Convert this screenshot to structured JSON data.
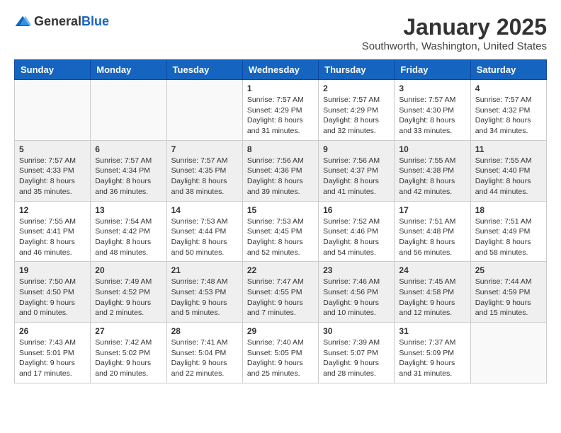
{
  "header": {
    "logo_general": "General",
    "logo_blue": "Blue",
    "month": "January 2025",
    "location": "Southworth, Washington, United States"
  },
  "days_of_week": [
    "Sunday",
    "Monday",
    "Tuesday",
    "Wednesday",
    "Thursday",
    "Friday",
    "Saturday"
  ],
  "weeks": [
    [
      {
        "day": "",
        "info": ""
      },
      {
        "day": "",
        "info": ""
      },
      {
        "day": "",
        "info": ""
      },
      {
        "day": "1",
        "info": "Sunrise: 7:57 AM\nSunset: 4:29 PM\nDaylight: 8 hours and 31 minutes."
      },
      {
        "day": "2",
        "info": "Sunrise: 7:57 AM\nSunset: 4:29 PM\nDaylight: 8 hours and 32 minutes."
      },
      {
        "day": "3",
        "info": "Sunrise: 7:57 AM\nSunset: 4:30 PM\nDaylight: 8 hours and 33 minutes."
      },
      {
        "day": "4",
        "info": "Sunrise: 7:57 AM\nSunset: 4:32 PM\nDaylight: 8 hours and 34 minutes."
      }
    ],
    [
      {
        "day": "5",
        "info": "Sunrise: 7:57 AM\nSunset: 4:33 PM\nDaylight: 8 hours and 35 minutes."
      },
      {
        "day": "6",
        "info": "Sunrise: 7:57 AM\nSunset: 4:34 PM\nDaylight: 8 hours and 36 minutes."
      },
      {
        "day": "7",
        "info": "Sunrise: 7:57 AM\nSunset: 4:35 PM\nDaylight: 8 hours and 38 minutes."
      },
      {
        "day": "8",
        "info": "Sunrise: 7:56 AM\nSunset: 4:36 PM\nDaylight: 8 hours and 39 minutes."
      },
      {
        "day": "9",
        "info": "Sunrise: 7:56 AM\nSunset: 4:37 PM\nDaylight: 8 hours and 41 minutes."
      },
      {
        "day": "10",
        "info": "Sunrise: 7:55 AM\nSunset: 4:38 PM\nDaylight: 8 hours and 42 minutes."
      },
      {
        "day": "11",
        "info": "Sunrise: 7:55 AM\nSunset: 4:40 PM\nDaylight: 8 hours and 44 minutes."
      }
    ],
    [
      {
        "day": "12",
        "info": "Sunrise: 7:55 AM\nSunset: 4:41 PM\nDaylight: 8 hours and 46 minutes."
      },
      {
        "day": "13",
        "info": "Sunrise: 7:54 AM\nSunset: 4:42 PM\nDaylight: 8 hours and 48 minutes."
      },
      {
        "day": "14",
        "info": "Sunrise: 7:53 AM\nSunset: 4:44 PM\nDaylight: 8 hours and 50 minutes."
      },
      {
        "day": "15",
        "info": "Sunrise: 7:53 AM\nSunset: 4:45 PM\nDaylight: 8 hours and 52 minutes."
      },
      {
        "day": "16",
        "info": "Sunrise: 7:52 AM\nSunset: 4:46 PM\nDaylight: 8 hours and 54 minutes."
      },
      {
        "day": "17",
        "info": "Sunrise: 7:51 AM\nSunset: 4:48 PM\nDaylight: 8 hours and 56 minutes."
      },
      {
        "day": "18",
        "info": "Sunrise: 7:51 AM\nSunset: 4:49 PM\nDaylight: 8 hours and 58 minutes."
      }
    ],
    [
      {
        "day": "19",
        "info": "Sunrise: 7:50 AM\nSunset: 4:50 PM\nDaylight: 9 hours and 0 minutes."
      },
      {
        "day": "20",
        "info": "Sunrise: 7:49 AM\nSunset: 4:52 PM\nDaylight: 9 hours and 2 minutes."
      },
      {
        "day": "21",
        "info": "Sunrise: 7:48 AM\nSunset: 4:53 PM\nDaylight: 9 hours and 5 minutes."
      },
      {
        "day": "22",
        "info": "Sunrise: 7:47 AM\nSunset: 4:55 PM\nDaylight: 9 hours and 7 minutes."
      },
      {
        "day": "23",
        "info": "Sunrise: 7:46 AM\nSunset: 4:56 PM\nDaylight: 9 hours and 10 minutes."
      },
      {
        "day": "24",
        "info": "Sunrise: 7:45 AM\nSunset: 4:58 PM\nDaylight: 9 hours and 12 minutes."
      },
      {
        "day": "25",
        "info": "Sunrise: 7:44 AM\nSunset: 4:59 PM\nDaylight: 9 hours and 15 minutes."
      }
    ],
    [
      {
        "day": "26",
        "info": "Sunrise: 7:43 AM\nSunset: 5:01 PM\nDaylight: 9 hours and 17 minutes."
      },
      {
        "day": "27",
        "info": "Sunrise: 7:42 AM\nSunset: 5:02 PM\nDaylight: 9 hours and 20 minutes."
      },
      {
        "day": "28",
        "info": "Sunrise: 7:41 AM\nSunset: 5:04 PM\nDaylight: 9 hours and 22 minutes."
      },
      {
        "day": "29",
        "info": "Sunrise: 7:40 AM\nSunset: 5:05 PM\nDaylight: 9 hours and 25 minutes."
      },
      {
        "day": "30",
        "info": "Sunrise: 7:39 AM\nSunset: 5:07 PM\nDaylight: 9 hours and 28 minutes."
      },
      {
        "day": "31",
        "info": "Sunrise: 7:37 AM\nSunset: 5:09 PM\nDaylight: 9 hours and 31 minutes."
      },
      {
        "day": "",
        "info": ""
      }
    ]
  ]
}
